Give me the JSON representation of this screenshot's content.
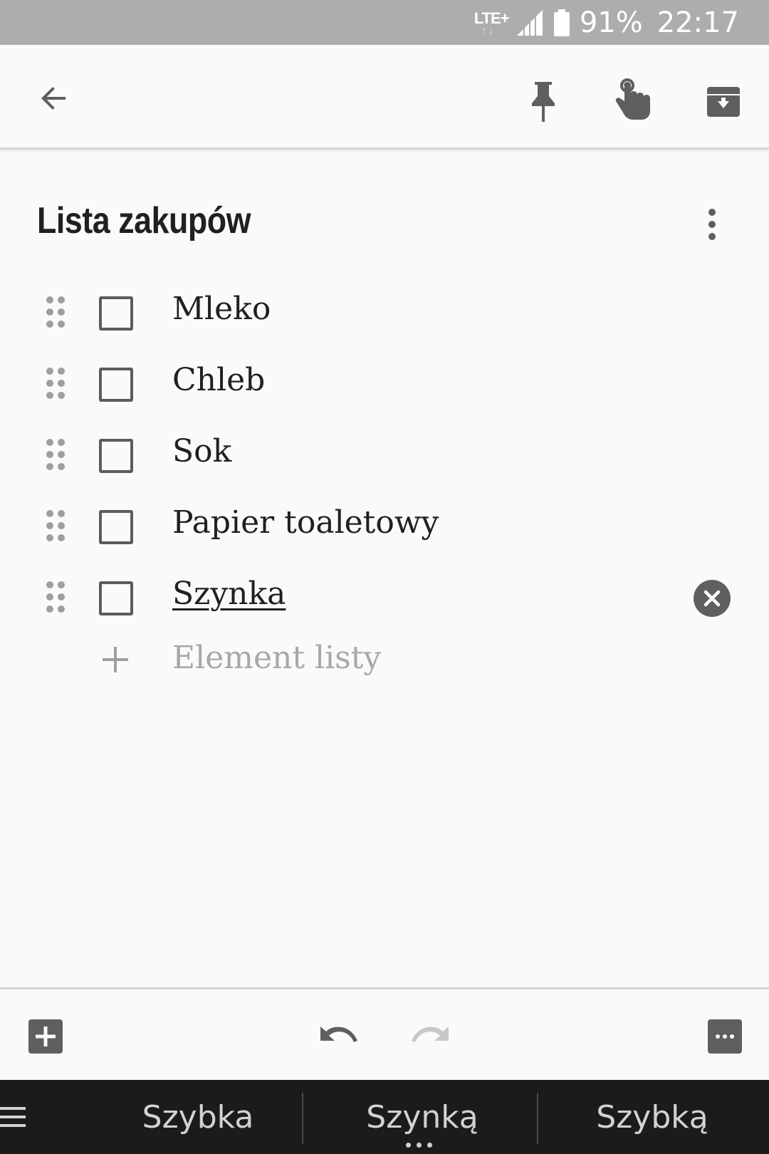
{
  "status_bar": {
    "network": "LTE+",
    "battery": "91%",
    "time": "22:17"
  },
  "app_bar": {
    "icons": [
      "back-arrow-icon",
      "pin-icon",
      "reminder-icon",
      "archive-icon"
    ]
  },
  "note": {
    "title": "Lista zakupów",
    "items": [
      {
        "text": "Mleko",
        "checked": false
      },
      {
        "text": "Chleb",
        "checked": false
      },
      {
        "text": "Sok",
        "checked": false
      },
      {
        "text": "Papier toaletowy",
        "checked": false
      },
      {
        "text": "Szynka",
        "checked": false,
        "editing": true
      }
    ],
    "add_item_placeholder": "Element listy"
  },
  "bottom_toolbar": {
    "icons": [
      "add-box-icon",
      "undo-icon",
      "redo-icon",
      "more-horiz-icon"
    ]
  },
  "keyboard": {
    "suggestions": [
      "Szybka",
      "Szynką",
      "Szybką"
    ]
  },
  "colors": {
    "status_bar": "#adadad",
    "background": "#fafafa",
    "keyboard_bar": "#1b1b1b",
    "icon": "#5f5f5f"
  }
}
